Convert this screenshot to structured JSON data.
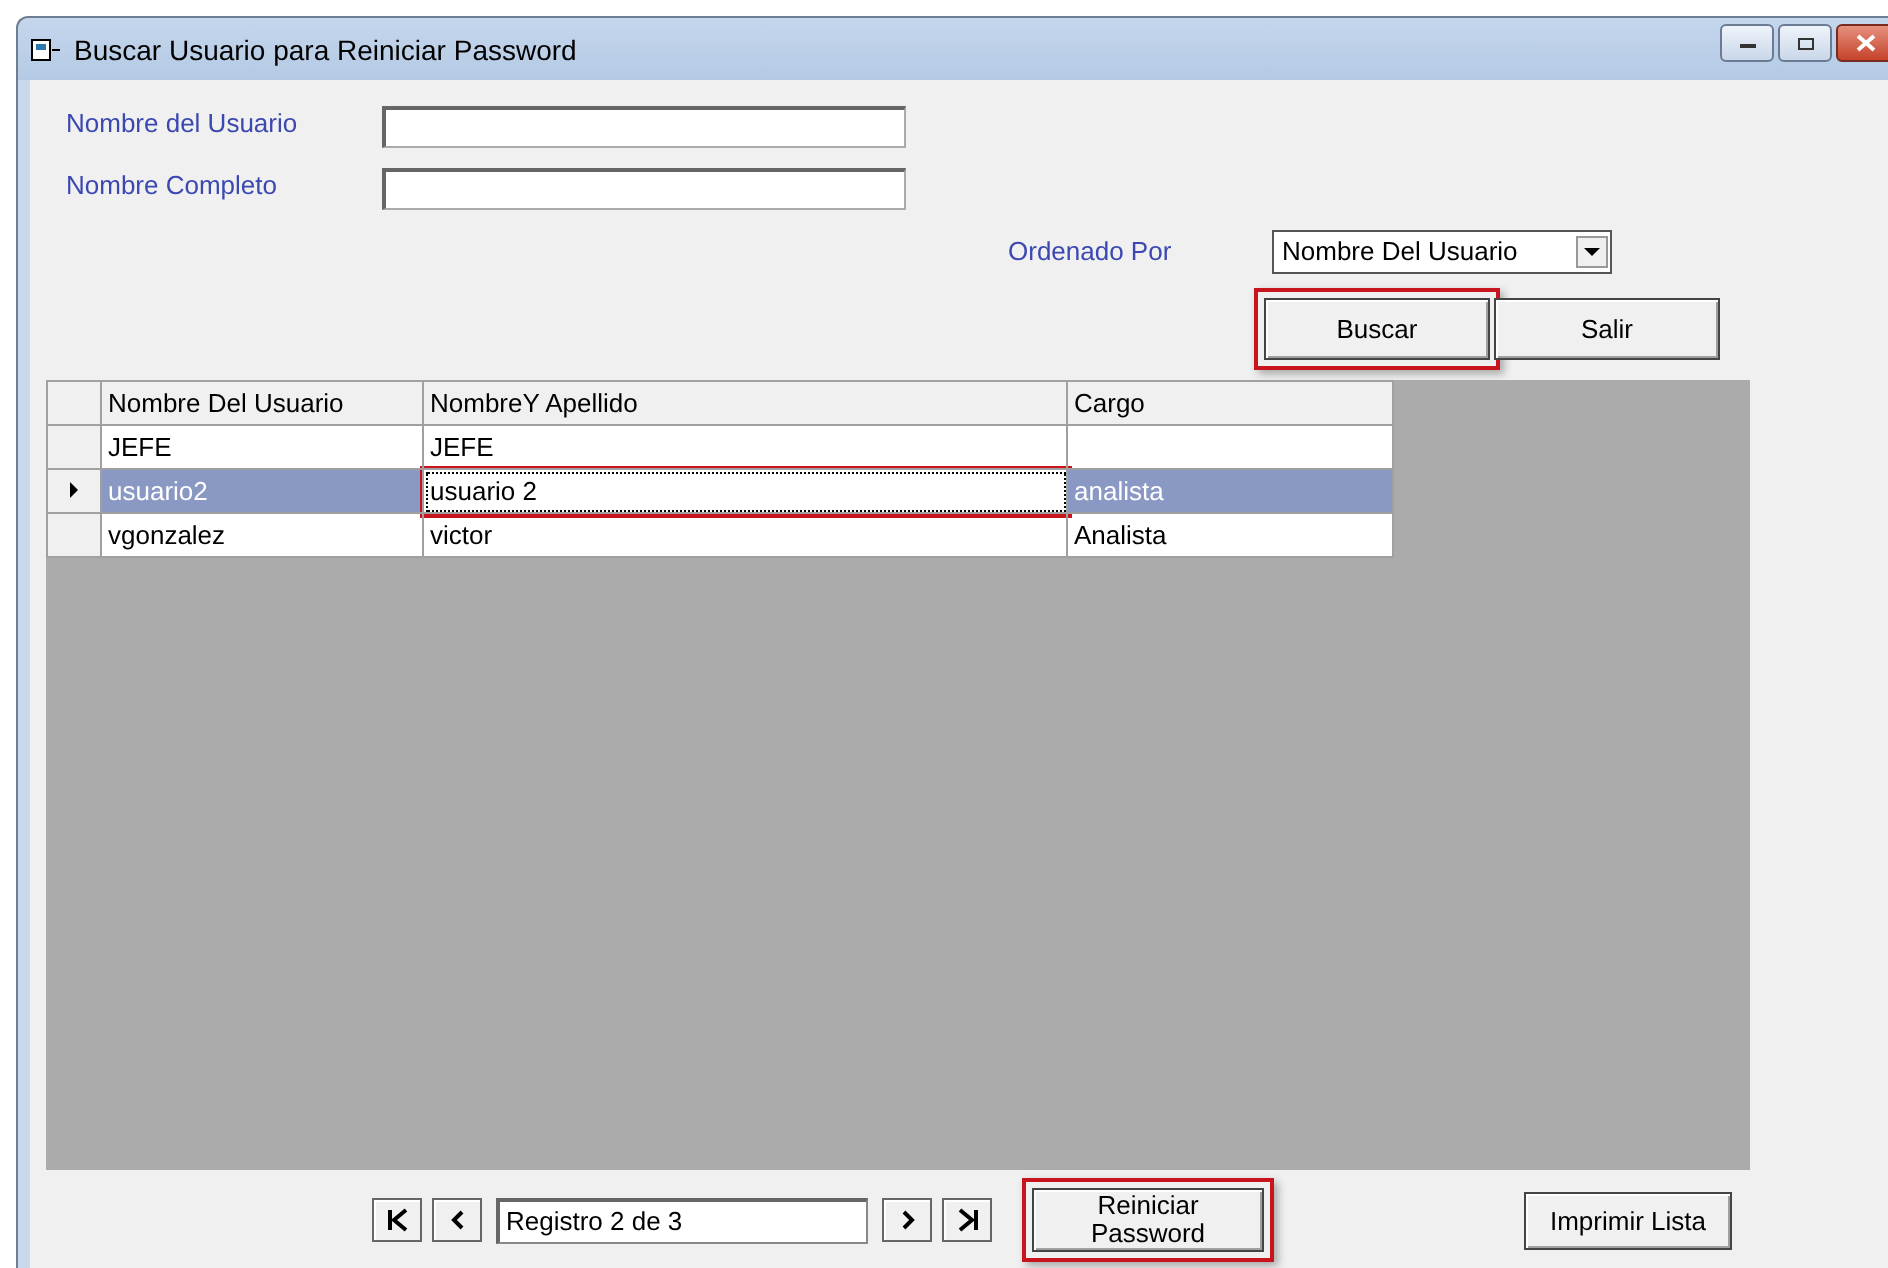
{
  "window": {
    "title": "Buscar Usuario para Reiniciar Password"
  },
  "fields": [
    {
      "label": "Nombre del Usuario"
    },
    {
      "label": "Nombre Completo"
    }
  ],
  "sort": {
    "label": "Ordenado Por",
    "value": "Nombre Del Usuario"
  },
  "top_buttons": [
    {
      "label": "Buscar",
      "highlighted": true
    },
    {
      "label": "Salir",
      "highlighted": false
    }
  ],
  "table": {
    "columns": [
      "Nombre Del Usuario",
      "NombreY Apellido",
      "Cargo"
    ],
    "rows": [
      {
        "cells": [
          "JEFE",
          "JEFE",
          ""
        ],
        "selected": false
      },
      {
        "cells": [
          "usuario2",
          "usuario 2",
          "analista"
        ],
        "selected": true
      },
      {
        "cells": [
          "vgonzalez",
          "victor",
          "Analista"
        ],
        "selected": false
      }
    ]
  },
  "navigator": {
    "record": "Registro 2 de 3"
  },
  "bottom_buttons": [
    {
      "label": "Reiniciar Password",
      "highlighted": true
    },
    {
      "label": "Imprimir Lista",
      "highlighted": false
    }
  ]
}
